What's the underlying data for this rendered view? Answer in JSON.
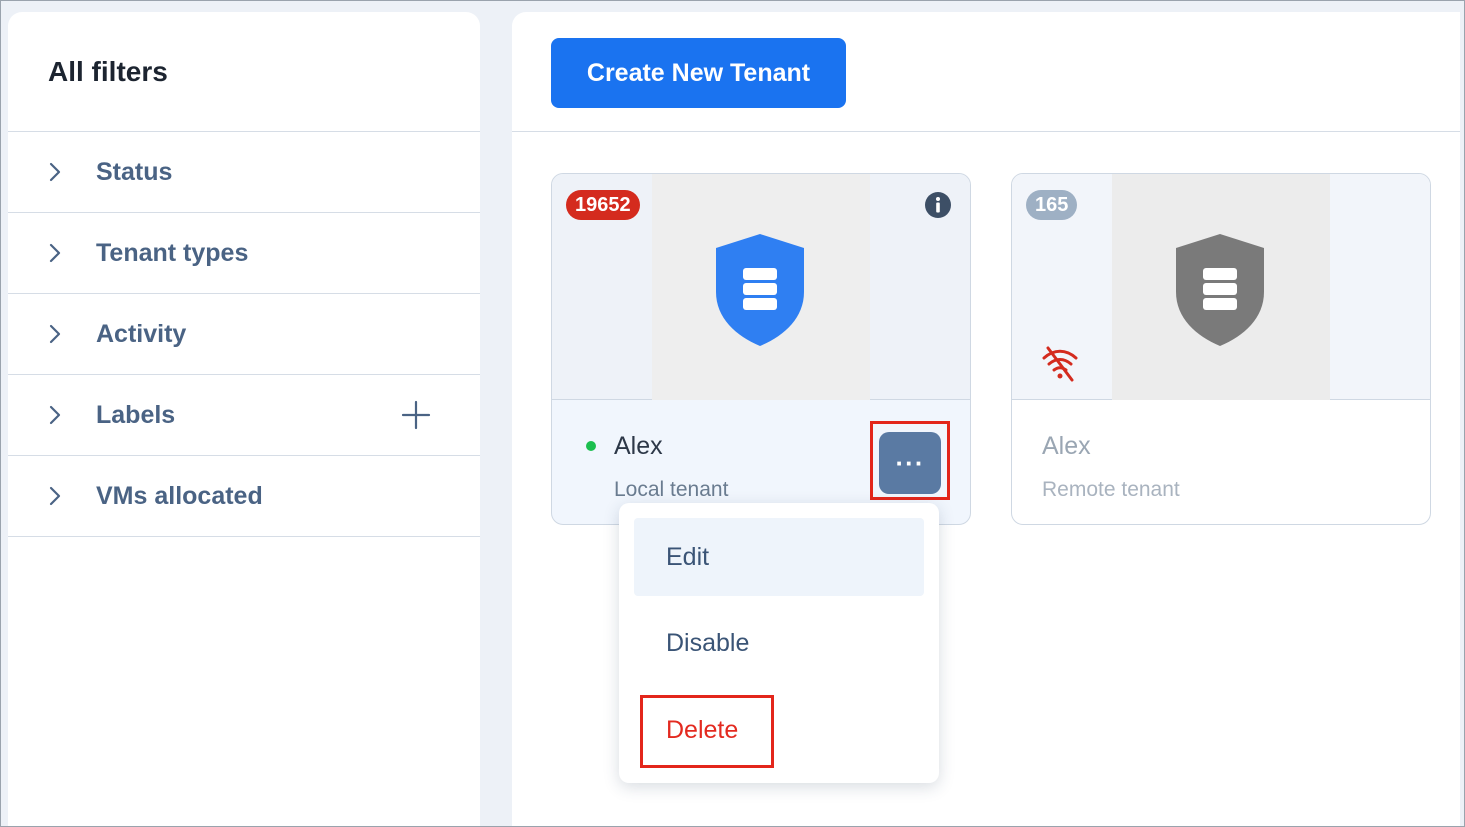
{
  "sidebar": {
    "title": "All filters",
    "items": [
      {
        "label": "Status"
      },
      {
        "label": "Tenant types"
      },
      {
        "label": "Activity"
      },
      {
        "label": "Labels"
      },
      {
        "label": "VMs allocated"
      }
    ]
  },
  "toolbar": {
    "create_label": "Create New Tenant"
  },
  "tenants": [
    {
      "count": "19652",
      "name": "Alex",
      "type": "Local tenant",
      "status": "online",
      "badge_color": "#d42b1e",
      "shield_color": "#2f7ff2"
    },
    {
      "count": "165",
      "name": "Alex",
      "type": "Remote tenant",
      "status": "disconnected",
      "badge_color": "#9eb0c4",
      "shield_color": "#7a7a7a"
    }
  ],
  "more_button": {
    "label": "···"
  },
  "menu": {
    "edit": "Edit",
    "disable": "Disable",
    "delete": "Delete"
  },
  "colors": {
    "accent": "#1a73f0",
    "danger": "#e3261b",
    "online": "#1cbf4f"
  }
}
